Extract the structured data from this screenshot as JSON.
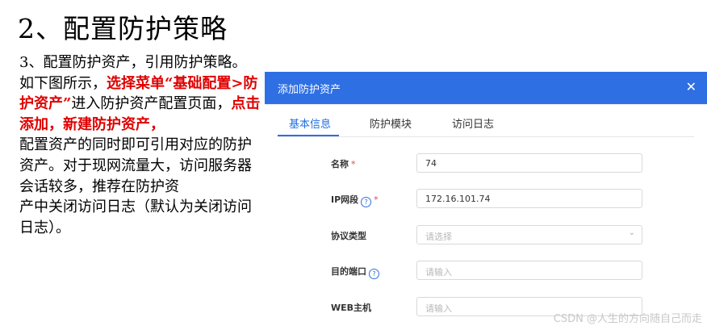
{
  "slide": {
    "title": "2、配置防护策略",
    "p1": "3、配置防护资产，引用防护策略。",
    "p2_a": "如下图所示，",
    "p2_red1": "选择菜单“基础配置>防护资产”",
    "p2_b": "进入防护资产配置页面，",
    "p2_red2": "点击添加，新建防护资产，",
    "p3": "配置资产的同时即可引用对应的防护资产。对于现网流量大，访问服务器会话较多，推荐在防护资",
    "p4": "产中关闭访问日志（默认为关闭访问日志）。"
  },
  "dialog": {
    "title": "添加防护资产",
    "close_icon": "close-icon",
    "tabs": [
      {
        "label": "基本信息",
        "active": true
      },
      {
        "label": "防护模块",
        "active": false
      },
      {
        "label": "访问日志",
        "active": false
      }
    ],
    "fields": {
      "name": {
        "label": "名称",
        "value": "74",
        "required": "*"
      },
      "ip": {
        "label": "IP网段",
        "value": "172.16.101.74",
        "required": "*",
        "help": "?"
      },
      "protocol": {
        "label": "协议类型",
        "placeholder": "请选择"
      },
      "port": {
        "label": "目的端口",
        "placeholder": "请输入",
        "help": "?"
      },
      "web_host": {
        "label": "WEB主机",
        "placeholder": "请输入"
      }
    }
  },
  "watermark": "CSDN @人生的方向随自己而走",
  "colors": {
    "header_blue": "#2f6fe4",
    "highlight_red": "#e00000",
    "required_red": "#e54545"
  }
}
